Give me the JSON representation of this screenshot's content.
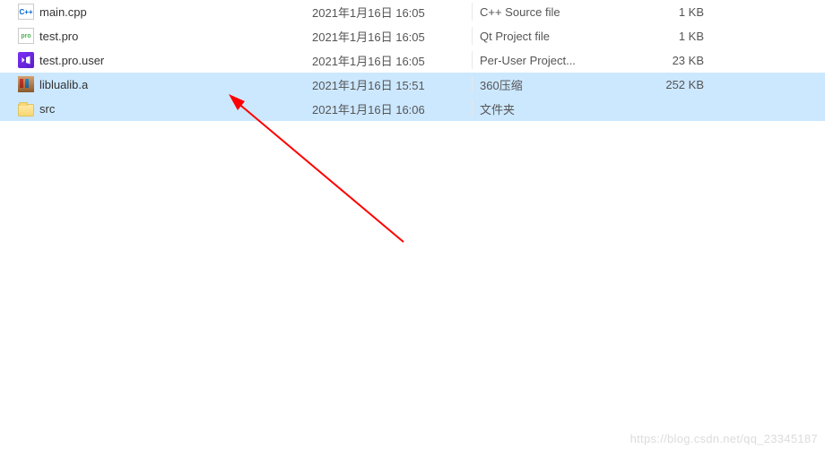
{
  "files": [
    {
      "icon": "cpp",
      "name": "main.cpp",
      "date": "2021年1月16日 16:05",
      "type": "C++ Source file",
      "size": "1 KB",
      "selected": false
    },
    {
      "icon": "pro",
      "name": "test.pro",
      "date": "2021年1月16日 16:05",
      "type": "Qt Project file",
      "size": "1 KB",
      "selected": false
    },
    {
      "icon": "user",
      "name": "test.pro.user",
      "date": "2021年1月16日 16:05",
      "type": "Per-User Project...",
      "size": "23 KB",
      "selected": false
    },
    {
      "icon": "archive",
      "name": "liblualib.a",
      "date": "2021年1月16日 15:51",
      "type": "360压缩",
      "size": "252 KB",
      "selected": true
    },
    {
      "icon": "folder",
      "name": "src",
      "date": "2021年1月16日 16:06",
      "type": "文件夹",
      "size": "",
      "selected": true
    }
  ],
  "icons": {
    "cpp": "C++",
    "pro": "pro"
  },
  "watermark": "https://blog.csdn.net/qq_23345187"
}
